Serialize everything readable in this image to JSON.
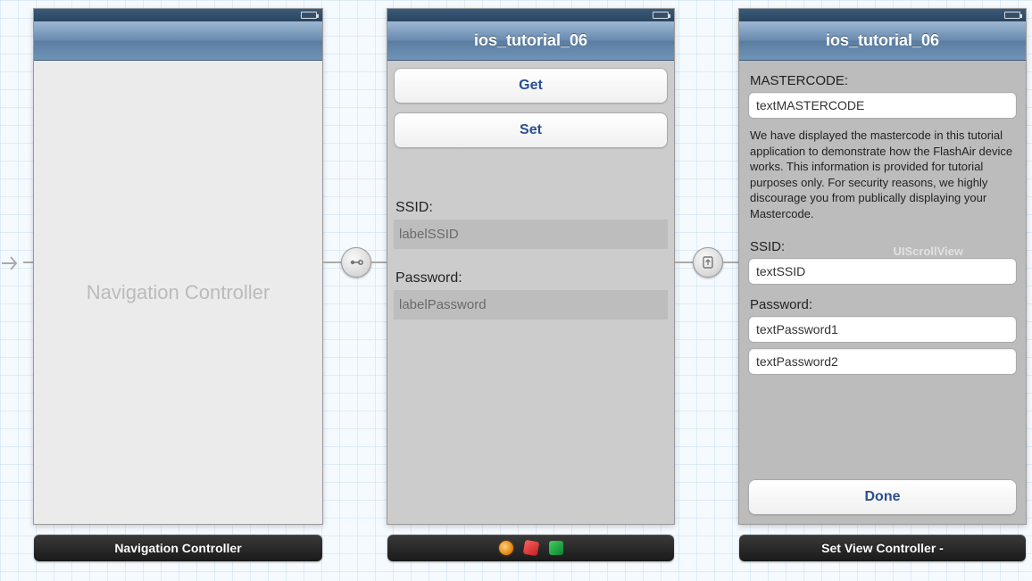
{
  "sceneA": {
    "placeholder": "Navigation Controller",
    "label": "Navigation Controller"
  },
  "sceneB": {
    "title": "ios_tutorial_06",
    "buttons": {
      "get": "Get",
      "set": "Set"
    },
    "ssid_label": "SSID:",
    "ssid_value": "labelSSID",
    "password_label": "Password:",
    "password_value": "labelPassword"
  },
  "sceneC": {
    "title": "ios_tutorial_06",
    "mastercode_label": "MASTERCODE:",
    "mastercode_value": "textMASTERCODE",
    "info": "We have displayed the mastercode in this tutorial application to demonstrate how the FlashAir device works. This information is provided for tutorial purposes only. For security reasons, we highly discourage you from publically displaying your Mastercode.",
    "ssid_label": "SSID:",
    "ssid_value": "textSSID",
    "password_label": "Password:",
    "password1_value": "textPassword1",
    "password2_value": "textPassword2",
    "scrollview_watermark": "UIScrollView",
    "done": "Done",
    "label": "Set View Controller -"
  }
}
